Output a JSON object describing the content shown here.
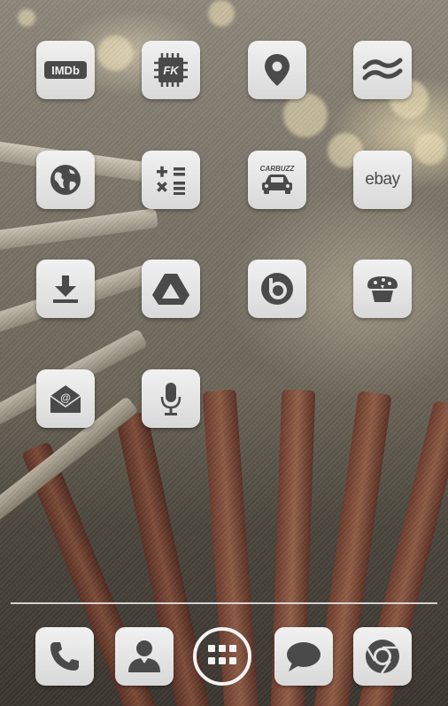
{
  "home_screen": {
    "apps": [
      {
        "name": "IMDb",
        "icon": "imdb-icon",
        "label_text": "IMDb"
      },
      {
        "name": "Franco Kernel",
        "icon": "chip-icon",
        "label_text": "FK"
      },
      {
        "name": "Maps",
        "icon": "map-pin-icon"
      },
      {
        "name": "Bacon Reader",
        "icon": "bacon-icon"
      },
      {
        "name": "Browser",
        "icon": "globe-icon"
      },
      {
        "name": "Calculator",
        "icon": "calculator-icon"
      },
      {
        "name": "CarBuzz",
        "icon": "car-icon",
        "label_text": "CARBUZZ"
      },
      {
        "name": "eBay",
        "icon": "ebay-icon",
        "label_text": "ebay"
      },
      {
        "name": "Downloads",
        "icon": "download-icon"
      },
      {
        "name": "Drive",
        "icon": "drive-icon"
      },
      {
        "name": "Beats",
        "icon": "beats-icon"
      },
      {
        "name": "Cupcake",
        "icon": "cupcake-icon"
      },
      {
        "name": "Email",
        "icon": "email-icon",
        "label_text": "@"
      },
      {
        "name": "Voice Search",
        "icon": "microphone-icon"
      }
    ]
  },
  "dock": {
    "items": [
      {
        "name": "Phone",
        "icon": "phone-icon"
      },
      {
        "name": "Contacts",
        "icon": "contact-icon"
      },
      {
        "name": "App Drawer",
        "icon": "grid-icon"
      },
      {
        "name": "Messaging",
        "icon": "chat-bubble-icon"
      },
      {
        "name": "Chrome",
        "icon": "chrome-icon"
      }
    ]
  },
  "colors": {
    "icon_tile": "#e6e6e6",
    "glyph": "#4a4a4a",
    "accent_line": "#f4f4f4"
  }
}
